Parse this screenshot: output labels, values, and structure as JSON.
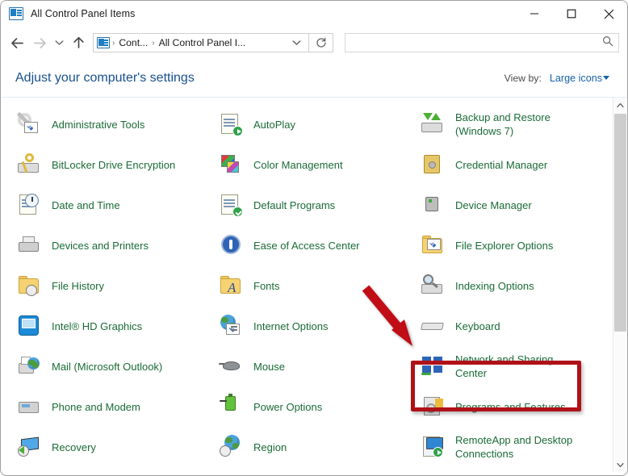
{
  "window": {
    "title": "All Control Panel Items",
    "title_icon": "control-panel-icon",
    "minimize_label": "Minimize",
    "maximize_label": "Maximize",
    "close_label": "Close"
  },
  "nav": {
    "back_label": "Back",
    "forward_label": "Forward",
    "recent_label": "Recent locations",
    "up_label": "Up",
    "refresh_label": "Refresh",
    "breadcrumb": [
      {
        "label": "Cont..."
      },
      {
        "label": "All Control Panel I..."
      }
    ],
    "breadcrumb_separator": "›",
    "address_dropdown_label": "Previous locations"
  },
  "search": {
    "value": "",
    "placeholder": "",
    "icon": "search-icon"
  },
  "header": {
    "heading": "Adjust your computer's settings",
    "view_by_label": "View by:",
    "view_by_value": "Large icons"
  },
  "columns": [
    {
      "items": [
        {
          "label": "Administrative Tools",
          "icon": "administrative-tools-icon"
        },
        {
          "label": "BitLocker Drive Encryption",
          "icon": "bitlocker-icon"
        },
        {
          "label": "Date and Time",
          "icon": "date-and-time-icon"
        },
        {
          "label": "Devices and Printers",
          "icon": "devices-and-printers-icon"
        },
        {
          "label": "File History",
          "icon": "file-history-icon"
        },
        {
          "label": "Intel® HD Graphics",
          "icon": "intel-hd-graphics-icon"
        },
        {
          "label": "Mail (Microsoft Outlook)",
          "icon": "mail-icon"
        },
        {
          "label": "Phone and Modem",
          "icon": "phone-and-modem-icon"
        },
        {
          "label": "Recovery",
          "icon": "recovery-icon"
        }
      ]
    },
    {
      "items": [
        {
          "label": "AutoPlay",
          "icon": "autoplay-icon"
        },
        {
          "label": "Color Management",
          "icon": "color-management-icon"
        },
        {
          "label": "Default Programs",
          "icon": "default-programs-icon"
        },
        {
          "label": "Ease of Access Center",
          "icon": "ease-of-access-icon"
        },
        {
          "label": "Fonts",
          "icon": "fonts-icon"
        },
        {
          "label": "Internet Options",
          "icon": "internet-options-icon"
        },
        {
          "label": "Mouse",
          "icon": "mouse-icon"
        },
        {
          "label": "Power Options",
          "icon": "power-options-icon"
        },
        {
          "label": "Region",
          "icon": "region-icon"
        }
      ]
    },
    {
      "items": [
        {
          "label": "Backup and Restore (Windows 7)",
          "icon": "backup-and-restore-icon"
        },
        {
          "label": "Credential Manager",
          "icon": "credential-manager-icon"
        },
        {
          "label": "Device Manager",
          "icon": "device-manager-icon"
        },
        {
          "label": "File Explorer Options",
          "icon": "file-explorer-options-icon"
        },
        {
          "label": "Indexing Options",
          "icon": "indexing-options-icon"
        },
        {
          "label": "Keyboard",
          "icon": "keyboard-icon"
        },
        {
          "label": "Network and Sharing Center",
          "icon": "network-and-sharing-center-icon"
        },
        {
          "label": "Programs and Features",
          "icon": "programs-and-features-icon"
        },
        {
          "label": "RemoteApp and Desktop Connections",
          "icon": "remoteapp-and-desktop-connections-icon"
        }
      ]
    }
  ],
  "annotation": {
    "highlight_target": "Indexing Options",
    "color": "#b01118",
    "arrow": "red-arrow-pointing-to-indexing-options"
  },
  "scrollbar": {
    "up_label": "Scroll up",
    "down_label": "Scroll down"
  },
  "colors": {
    "item_text": "#1a6b36",
    "heading_text": "#17508f",
    "link_text": "#1461a8",
    "annotation_red": "#b01118"
  }
}
